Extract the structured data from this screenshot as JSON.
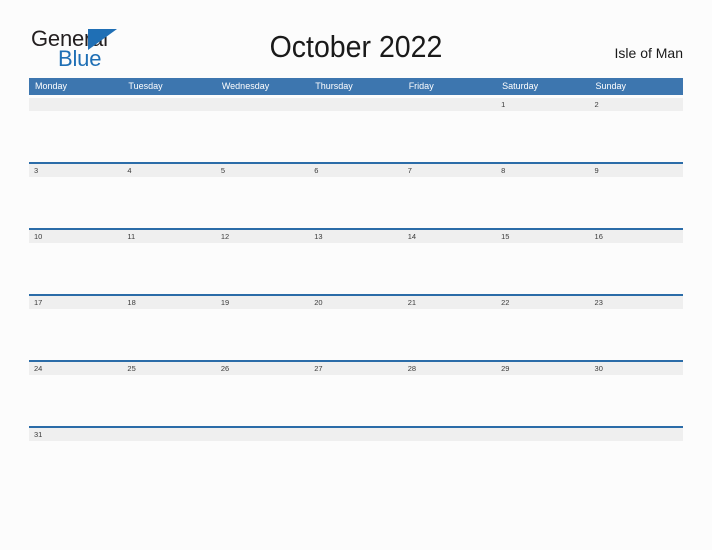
{
  "brand": {
    "name_part1": "General",
    "name_part2": "Blue",
    "color_black": "#231f20",
    "color_blue": "#1f6fb5",
    "triangle_icon": "triangle-icon"
  },
  "header": {
    "title": "October 2022",
    "location": "Isle of Man"
  },
  "colors": {
    "header_blue": "#3d76af",
    "rule_blue": "#2b6ca8",
    "cell_gray": "#efefef",
    "page_background": "#fcfcfc",
    "date_text": "#3b3b3b"
  },
  "calendar": {
    "month": "October",
    "year": "2022",
    "daynames": [
      "Monday",
      "Tuesday",
      "Wednesday",
      "Thursday",
      "Friday",
      "Saturday",
      "Sunday"
    ],
    "weeks": [
      [
        "",
        "",
        "",
        "",
        "",
        "1",
        "2"
      ],
      [
        "3",
        "4",
        "5",
        "6",
        "7",
        "8",
        "9"
      ],
      [
        "10",
        "11",
        "12",
        "13",
        "14",
        "15",
        "16"
      ],
      [
        "17",
        "18",
        "19",
        "20",
        "21",
        "22",
        "23"
      ],
      [
        "24",
        "25",
        "26",
        "27",
        "28",
        "29",
        "30"
      ],
      [
        "31",
        "",
        "",
        "",
        "",
        "",
        ""
      ]
    ]
  }
}
